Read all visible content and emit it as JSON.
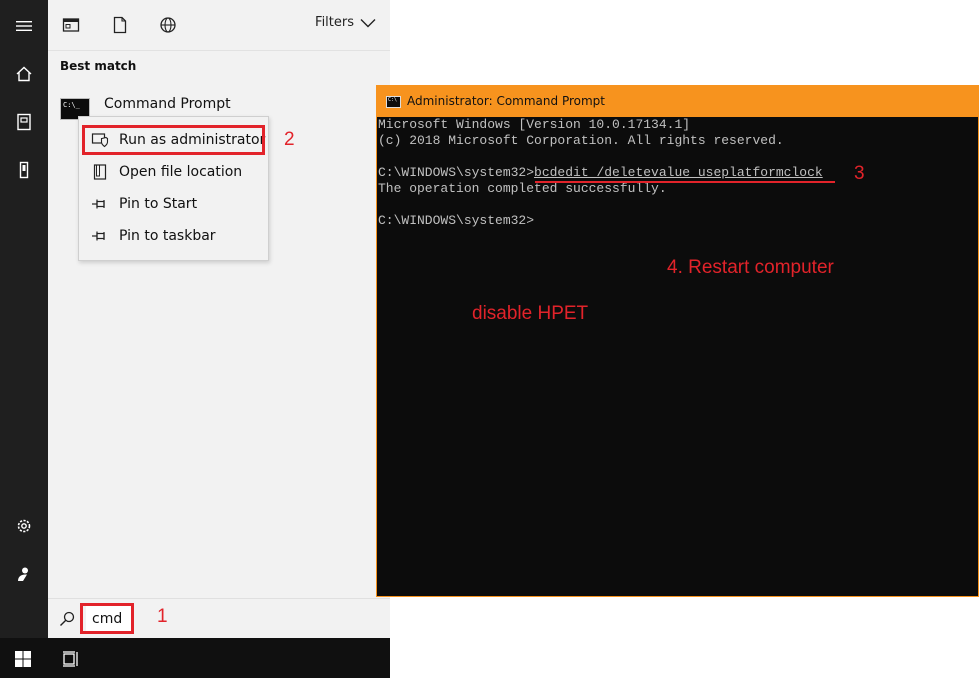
{
  "rail": {
    "items": [
      {
        "icon": "hamburger-icon"
      },
      {
        "icon": "home-icon"
      },
      {
        "icon": "documents-icon"
      },
      {
        "icon": "device-icon"
      },
      {
        "icon": "settings-gear-icon"
      },
      {
        "icon": "account-icon"
      }
    ]
  },
  "panel": {
    "filters_label": "Filters",
    "best_match_label": "Best match",
    "result_title": "Command Prompt",
    "result_icon_text": "C:\\_"
  },
  "context_menu": {
    "items": [
      {
        "label": "Run as administrator",
        "icon": "shield-icon"
      },
      {
        "label": "Open file location",
        "icon": "file-icon"
      },
      {
        "label": "Pin to Start",
        "icon": "pin-icon"
      },
      {
        "label": "Pin to taskbar",
        "icon": "pin-icon"
      }
    ]
  },
  "search": {
    "value": "cmd"
  },
  "annotations": {
    "step1": "1",
    "step2": "2",
    "step3": "3",
    "step4": "4. Restart computer",
    "note": "disable HPET",
    "accent": "#e2232a"
  },
  "cmd_window": {
    "title": "Administrator: Command Prompt",
    "title_icon_text": "C:\\",
    "accent": "#f7931e",
    "lines": [
      "Microsoft Windows [Version 10.0.17134.1]",
      "(c) 2018 Microsoft Corporation. All rights reserved.",
      "",
      "",
      "The operation completed successfully.",
      "",
      "C:\\WINDOWS\\system32>"
    ],
    "prompt": "C:\\WINDOWS\\system32>",
    "command": "bcdedit /deletevalue useplatformclock"
  }
}
